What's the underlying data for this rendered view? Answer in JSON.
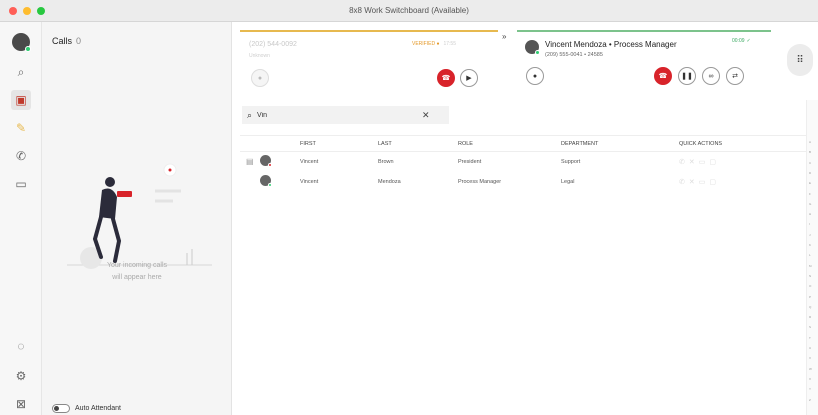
{
  "window": {
    "title": "8x8 Work Switchboard (Available)"
  },
  "rail": {
    "items": [
      {
        "name": "search-icon",
        "glyph": "⌕"
      },
      {
        "name": "switchboard-icon",
        "glyph": "▣"
      },
      {
        "name": "pencil-icon",
        "glyph": "✎"
      },
      {
        "name": "phone-icon",
        "glyph": "✆"
      },
      {
        "name": "chat-icon",
        "glyph": "▭"
      },
      {
        "name": "support-icon",
        "glyph": "◌"
      },
      {
        "name": "gear-icon",
        "glyph": "⚙"
      },
      {
        "name": "gift-icon",
        "glyph": "⊠"
      }
    ]
  },
  "calls": {
    "title": "Calls",
    "count": "0",
    "empty_line1": "Your incoming calls",
    "empty_line2": "will appear here",
    "auto_attendant_label": "Auto Attendant"
  },
  "call1": {
    "number": "(202) 544-0092",
    "sub": "Unknown",
    "status": "VERIFIED ●",
    "time": "17:55"
  },
  "call2": {
    "name": "Vincent Mendoza • Process Manager",
    "detail": "(209) 555-0041 • 24585",
    "time": "00:09"
  },
  "search": {
    "value": "Vin"
  },
  "table": {
    "headers": [
      "FIRST",
      "LAST",
      "ROLE",
      "DEPARTMENT",
      "QUICK ACTIONS"
    ],
    "rows": [
      {
        "first": "Vincent",
        "last": "Brown",
        "role": "President",
        "department": "Support",
        "presence": "#d8232a"
      },
      {
        "first": "Vincent",
        "last": "Mendoza",
        "role": "Process Manager",
        "department": "Legal",
        "presence": "#2ecc71"
      }
    ]
  },
  "index": [
    "A",
    "B",
    "C",
    "D",
    "E",
    "F",
    "G",
    "H",
    "I",
    "J",
    "K",
    "L",
    "M",
    "N",
    "O",
    "P",
    "Q",
    "R",
    "S",
    "T",
    "U",
    "V",
    "W",
    "X",
    "Y",
    "Z"
  ],
  "colors": {
    "end_call": "#d8232a",
    "pending_bar": "#e7b94f",
    "active_bar": "#7cc38c",
    "active_tab": "#c0392b"
  }
}
